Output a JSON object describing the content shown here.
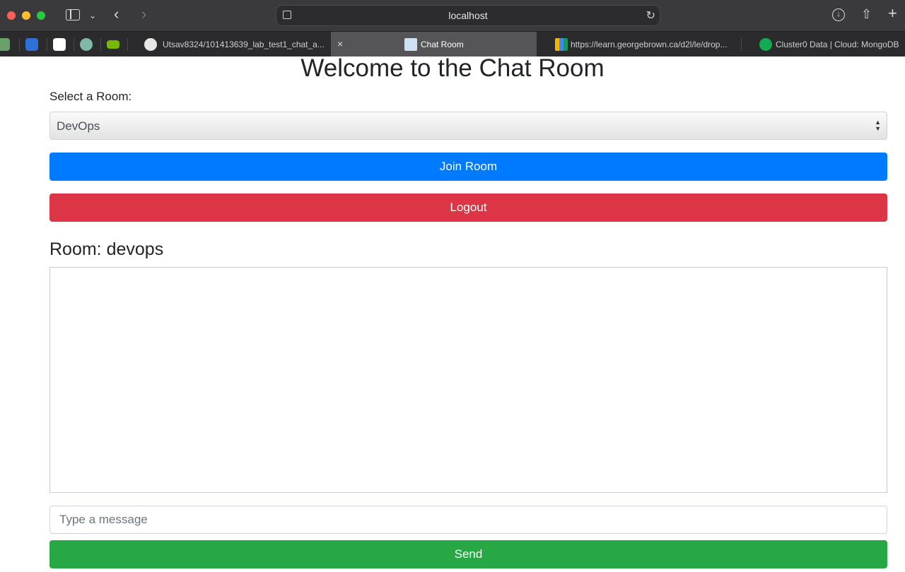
{
  "browser": {
    "address": "localhost",
    "tabs": [
      {
        "label": "Utsav8324/101413639_lab_test1_chat_a...",
        "icon": "github-icon",
        "active": false
      },
      {
        "label": "Chat Room",
        "icon": "document-icon",
        "active": true
      },
      {
        "label": "https://learn.georgebrown.ca/d2l/le/drop...",
        "icon": "grid-icon",
        "active": false
      },
      {
        "label": "Cluster0 Data | Cloud: MongoDB",
        "icon": "mongodb-leaf-icon",
        "active": false
      }
    ]
  },
  "page": {
    "title": "Welcome to the Chat Room",
    "select_label": "Select a Room:",
    "selected_room": "DevOps",
    "join_button": "Join Room",
    "logout_button": "Logout",
    "room_heading": "Room: devops",
    "message_placeholder": "Type a message",
    "send_button": "Send"
  },
  "colors": {
    "join": "#007bff",
    "logout": "#dc3545",
    "send": "#28a745"
  }
}
